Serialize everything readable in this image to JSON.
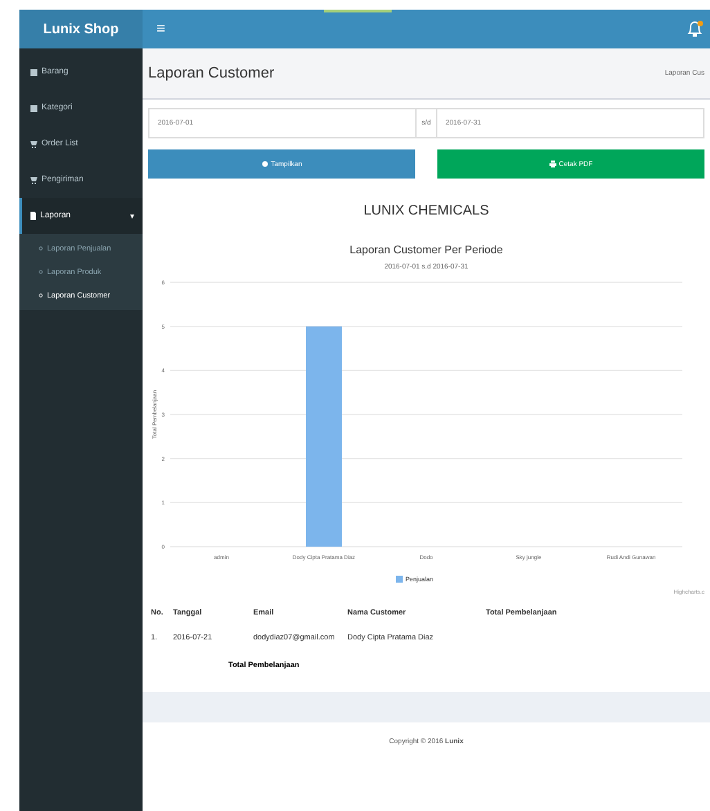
{
  "brand": "Lunix Shop",
  "topbar": {
    "menu_glyph": "≡",
    "notifications": true
  },
  "sidebar": {
    "items": [
      {
        "label": "Barang",
        "selected": false
      },
      {
        "label": "Kategori",
        "selected": false
      },
      {
        "label": "Order List",
        "selected": false
      },
      {
        "label": "Pengiriman",
        "selected": false
      },
      {
        "label": "Laporan",
        "selected": true,
        "expanded": true,
        "children": [
          {
            "label": "Laporan Penjualan",
            "selected": false
          },
          {
            "label": "Laporan Produk",
            "selected": false
          },
          {
            "label": "Laporan Customer",
            "selected": true
          }
        ]
      }
    ]
  },
  "page": {
    "title": "Laporan Customer",
    "breadcrumb": "Laporan Cus"
  },
  "filter": {
    "from": "2016-07-01",
    "separator": "s/d",
    "to": "2016-07-31"
  },
  "buttons": [
    {
      "label": "Tampilkan",
      "kind": "primary"
    },
    {
      "label": "Cetak PDF",
      "kind": "success"
    }
  ],
  "report": {
    "company": "LUNIX CHEMICALS",
    "title": "Laporan Customer Per Periode",
    "period": "2016-07-01 s.d 2016-07-31",
    "chart_data": {
      "type": "bar",
      "ylabel": "Total Pembelanjaan",
      "categories": [
        "admin",
        "Dody Cipta Pratama Diaz",
        "Dodo",
        "Sky jungle",
        "Rudi Andi Gunawan"
      ],
      "series": [
        {
          "name": "Penjualan",
          "color": "#7cb5ec",
          "values": [
            0,
            5,
            0,
            0,
            0
          ]
        }
      ],
      "grid": true,
      "ylim": [
        0,
        6
      ],
      "yticks": [
        0,
        1,
        2,
        3,
        4,
        5,
        6
      ]
    },
    "credit": "Highcharts.c"
  },
  "table": {
    "columns": [
      "No.",
      "Tanggal",
      "Email",
      "Nama Customer",
      "Total Pembelanjaan"
    ],
    "rows": [
      [
        "1.",
        "2016-07-21",
        "dodydiaz07@gmail.com",
        "Dody Cipta Pratama Diaz"
      ]
    ],
    "total_label": "Total Pembelanjaan"
  },
  "footer": {
    "prefix": "Copyright © 2016 ",
    "brand": "Lunix"
  }
}
